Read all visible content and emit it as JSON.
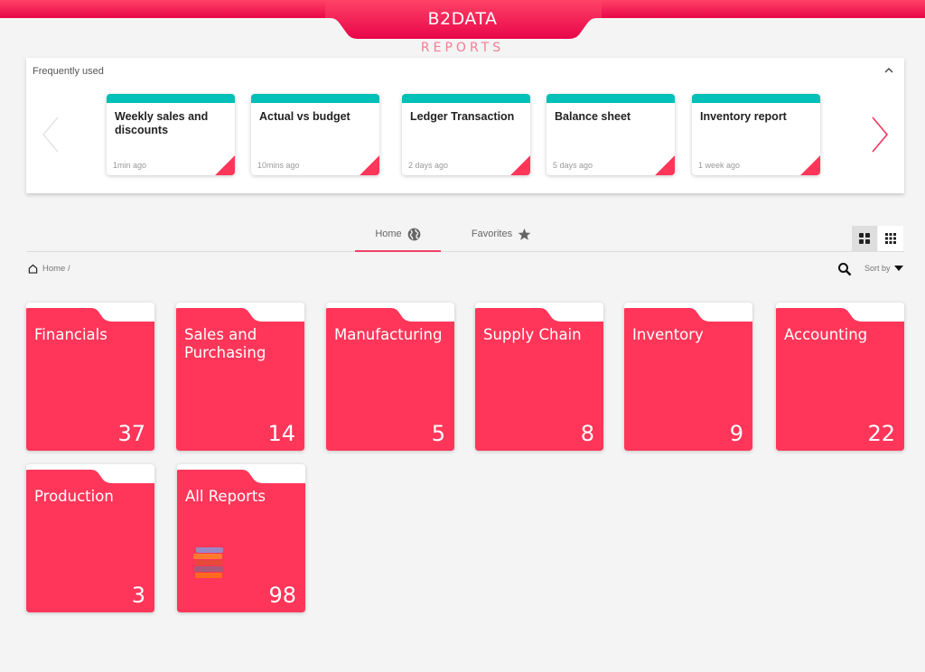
{
  "header": {
    "brand": "B2DATA",
    "subtitle": "REPORTS"
  },
  "colors": {
    "primary": "#ff3659",
    "accent_teal": "#00bfb6",
    "tab_underline": "#f14066"
  },
  "frequently_used": {
    "title": "Frequently used",
    "collapse_icon": "chevron-up-icon",
    "cards": [
      {
        "title": "Weekly sales and discounts",
        "time": "1min ago"
      },
      {
        "title": "Actual vs budget",
        "time": "10mins ago"
      },
      {
        "title": "Ledger Transaction",
        "time": "2 days ago"
      },
      {
        "title": "Balance sheet",
        "time": "5 days ago"
      },
      {
        "title": "Inventory report",
        "time": "1 week ago"
      }
    ]
  },
  "tabs": [
    {
      "label": "Home",
      "icon": "globe-icon",
      "active": true
    },
    {
      "label": "Favorites",
      "icon": "star-icon",
      "active": false
    }
  ],
  "breadcrumb": {
    "text": "Home /"
  },
  "toolbar": {
    "sort_label": "Sort by"
  },
  "folders": [
    {
      "name": "Financials",
      "count": "37"
    },
    {
      "name": "Sales and Purchasing",
      "count": "14"
    },
    {
      "name": "Manufacturing",
      "count": "5"
    },
    {
      "name": "Supply Chain",
      "count": "8"
    },
    {
      "name": "Inventory",
      "count": "9"
    },
    {
      "name": "Accounting",
      "count": "22"
    },
    {
      "name": "Production",
      "count": "3"
    },
    {
      "name": "All Reports",
      "count": "98"
    }
  ]
}
